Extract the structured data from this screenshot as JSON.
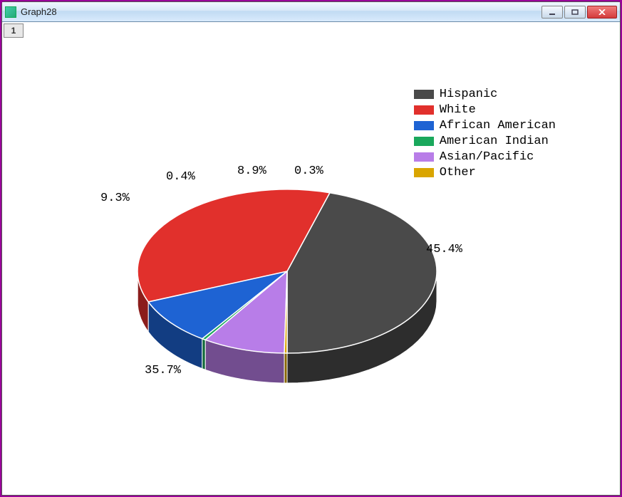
{
  "window": {
    "title": "Graph28",
    "tab": "1"
  },
  "legend": {
    "items": [
      {
        "label": "Hispanic",
        "color": "#4a4a4a"
      },
      {
        "label": "White",
        "color": "#e1302c"
      },
      {
        "label": "African American",
        "color": "#1e63d3"
      },
      {
        "label": "American Indian",
        "color": "#1aa85c"
      },
      {
        "label": "Asian/Pacific",
        "color": "#b87de8"
      },
      {
        "label": "Other",
        "color": "#d9a500"
      }
    ]
  },
  "labels": {
    "hispanic": "45.4%",
    "white": "35.7%",
    "afam": "9.3%",
    "aind": "0.4%",
    "asian": "8.9%",
    "other": "0.3%"
  },
  "chart_data": {
    "type": "pie",
    "title": "",
    "series": [
      {
        "name": "Hispanic",
        "value": 45.4,
        "color": "#4a4a4a"
      },
      {
        "name": "White",
        "value": 35.7,
        "color": "#e1302c"
      },
      {
        "name": "African American",
        "value": 9.3,
        "color": "#1e63d3"
      },
      {
        "name": "American Indian",
        "value": 0.4,
        "color": "#1aa85c"
      },
      {
        "name": "Asian/Pacific",
        "value": 8.9,
        "color": "#b87de8"
      },
      {
        "name": "Other",
        "value": 0.3,
        "color": "#d9a500"
      }
    ]
  }
}
